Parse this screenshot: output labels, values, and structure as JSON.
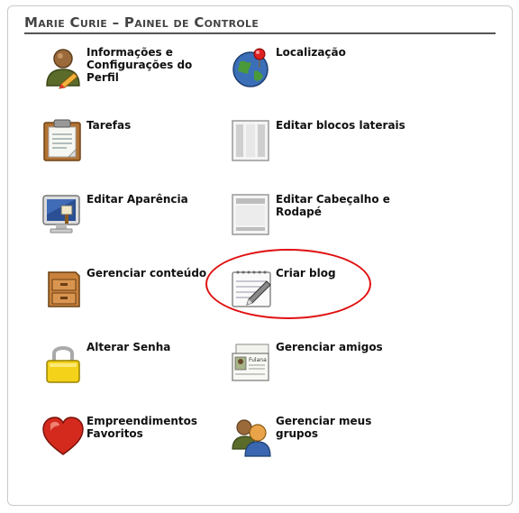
{
  "panel": {
    "title": "Marie Curie – Painel de Controle"
  },
  "items": [
    {
      "label": "Informações e Configurações do Perfil",
      "icon": "user-profile-icon"
    },
    {
      "label": "Localização",
      "icon": "globe-pin-icon"
    },
    {
      "label": "Tarefas",
      "icon": "clipboard-icon"
    },
    {
      "label": "Editar blocos laterais",
      "icon": "sidebar-layout-icon"
    },
    {
      "label": "Editar Aparência",
      "icon": "monitor-paint-icon"
    },
    {
      "label": "Editar Cabeçalho e Rodapé",
      "icon": "header-footer-layout-icon"
    },
    {
      "label": "Gerenciar conteúdo",
      "icon": "filing-cabinet-icon"
    },
    {
      "label": "Criar blog",
      "icon": "notepad-pencil-icon"
    },
    {
      "label": "Alterar Senha",
      "icon": "padlock-icon"
    },
    {
      "label": "Gerenciar amigos",
      "icon": "id-cards-icon"
    },
    {
      "label": "Empreendimentos Favoritos",
      "icon": "heart-icon"
    },
    {
      "label": "Gerenciar meus grupos",
      "icon": "group-users-icon"
    }
  ],
  "friend_card": {
    "name_text": "Fulana"
  },
  "colors": {
    "highlight": "#e01010",
    "title_rule": "#555555"
  }
}
